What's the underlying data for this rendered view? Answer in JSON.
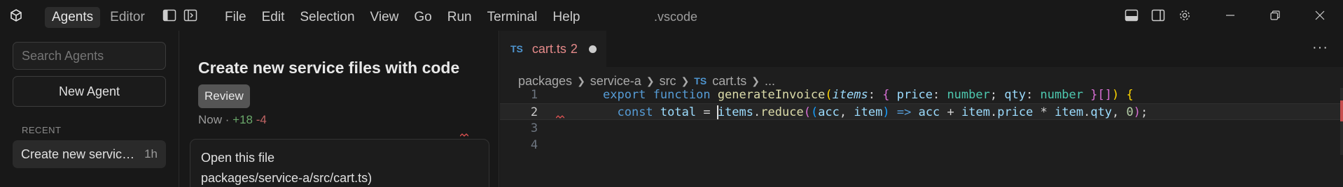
{
  "titlebar": {
    "mode_tabs": [
      {
        "label": "Agents",
        "active": true
      },
      {
        "label": "Editor",
        "active": false
      }
    ],
    "menu": [
      "File",
      "Edit",
      "Selection",
      "View",
      "Go",
      "Run",
      "Terminal",
      "Help"
    ],
    "window_title": ".vscode"
  },
  "agents": {
    "search_placeholder": "Search Agents",
    "new_agent_label": "New Agent",
    "recent_label": "RECENT",
    "recent_items": [
      {
        "title": "Create new service files with code",
        "time": "1h"
      }
    ]
  },
  "chat": {
    "title": "Create new service files with code",
    "review_label": "Review",
    "time": "Now",
    "separator": "·",
    "additions": "+18",
    "deletions": "-4",
    "message_line1": "Open this file",
    "message_line2": "packages/service-a/src/cart.ts)"
  },
  "editor": {
    "tab": {
      "lang_badge": "TS",
      "filename": "cart.ts",
      "problem_count": "2",
      "dirty": true
    },
    "more_label": "···",
    "breadcrumb": [
      "packages",
      "service-a",
      "src",
      "cart.ts",
      "..."
    ],
    "breadcrumb_file_badge": "TS",
    "line_numbers": [
      "1",
      "2",
      "3",
      "4"
    ],
    "active_line": 2
  },
  "colors": {
    "accent_ts": "#4e94ce",
    "error": "#e58a8a",
    "diff_add": "#6aa86a",
    "diff_del": "#c06464"
  }
}
